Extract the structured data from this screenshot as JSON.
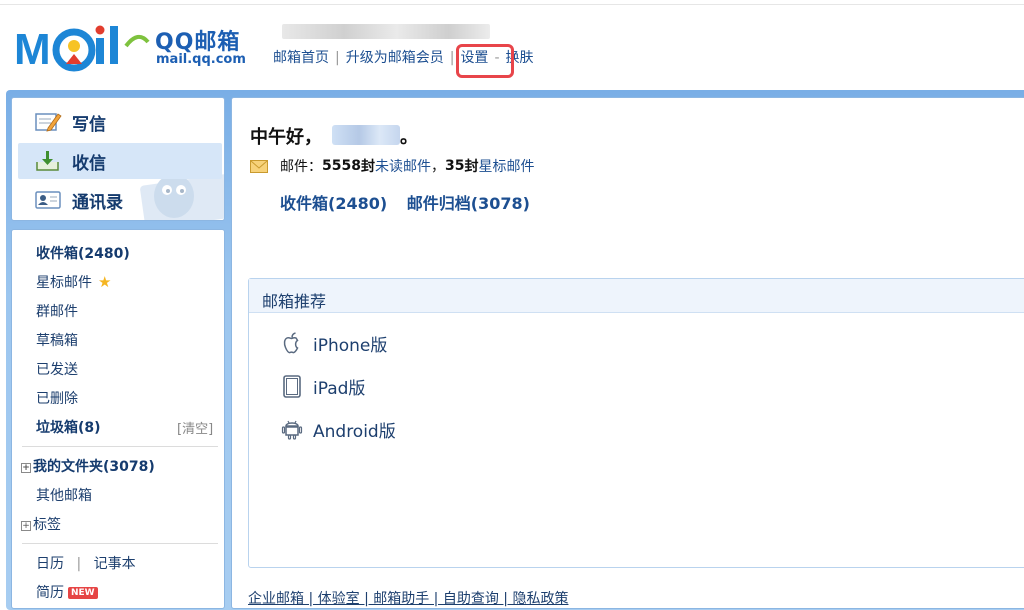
{
  "header": {
    "brand": "QQ邮箱",
    "brand_url": "mail.qq.com",
    "nav": [
      {
        "label": "邮箱首页"
      },
      {
        "label": "升级为邮箱会员"
      },
      {
        "label": "设置"
      },
      {
        "label": "换肤"
      }
    ]
  },
  "sidebar": {
    "actions": [
      {
        "label": "写信"
      },
      {
        "label": "收信"
      },
      {
        "label": "通讯录"
      }
    ],
    "folders": {
      "inbox": "收件箱(2480)",
      "starred": "星标邮件",
      "group": "群邮件",
      "drafts": "草稿箱",
      "sent": "已发送",
      "deleted": "已删除",
      "spam": "垃圾箱(8)",
      "clear": "[清空]",
      "my_folders": "我的文件夹(3078)",
      "other": "其他邮箱",
      "tags": "标签",
      "calendar": "日历",
      "notes": "记事本",
      "resume": "简历",
      "new_badge": "NEW"
    }
  },
  "main": {
    "greeting": "中午好，",
    "greeting_end": "。",
    "mail_label": "邮件：",
    "unread_count": "5558",
    "unread_unit": " 封",
    "unread_link": "未读邮件",
    "comma": "，",
    "starred_count": "35",
    "starred_unit": " 封",
    "starred_link": "星标邮件",
    "quick_links": [
      "收件箱(2480)",
      "邮件归档(3078)"
    ],
    "recommend": {
      "title": "邮箱推荐",
      "apps": [
        {
          "label": "iPhone版",
          "icon": "apple-icon"
        },
        {
          "label": "iPad版",
          "icon": "ipad-icon"
        },
        {
          "label": "Android版",
          "icon": "android-icon"
        }
      ]
    },
    "footer_links": "企业邮箱 | 体验室 | 邮箱助手 | 自助查询 | 隐私政策"
  },
  "colors": {
    "brand_blue": "#1d5fb3",
    "link_blue": "#1d4f91",
    "frame_blue": "#79aee6",
    "highlight_red": "#e8454a"
  }
}
